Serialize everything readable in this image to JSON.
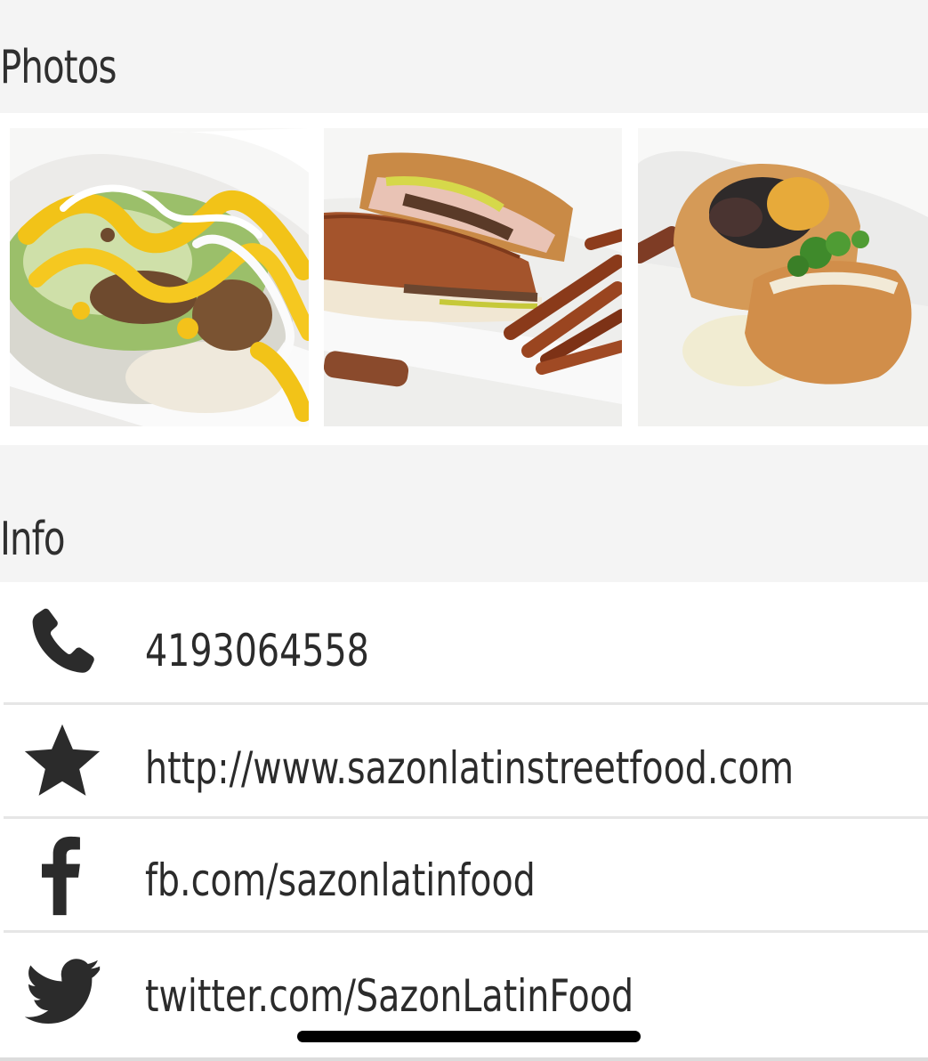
{
  "photos": {
    "title": "Photos",
    "items": [
      {
        "alt": "nachos-plate"
      },
      {
        "alt": "cuban-sandwich-fries"
      },
      {
        "alt": "empanada-with-sauce"
      }
    ]
  },
  "info": {
    "title": "Info",
    "rows": [
      {
        "icon": "phone-icon",
        "text": "4193064558"
      },
      {
        "icon": "star-icon",
        "text": "http://www.sazonlatinstreetfood.com"
      },
      {
        "icon": "facebook-icon",
        "text": "fb.com/sazonlatinfood"
      },
      {
        "icon": "twitter-icon",
        "text": "twitter.com/SazonLatinFood"
      }
    ]
  },
  "colors": {
    "section_bg": "#f4f4f4",
    "row_bg": "#ffffff",
    "text": "#2b2b2b",
    "divider": "#e6e6e6"
  }
}
